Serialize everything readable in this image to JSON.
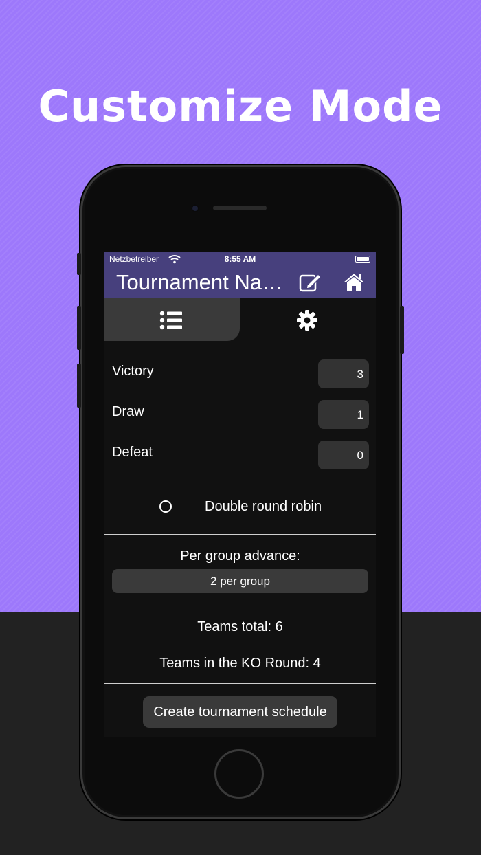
{
  "headline": "Customize Mode",
  "status_bar": {
    "carrier": "Netzbetreiber",
    "time": "8:55 AM"
  },
  "nav": {
    "title": "Tournament Na…",
    "icons": [
      "edit-icon",
      "home-icon"
    ]
  },
  "tabs": [
    {
      "icon": "list-icon",
      "selected": true
    },
    {
      "icon": "gear-icon",
      "selected": false
    }
  ],
  "points": [
    {
      "label": "Victory",
      "value": "3"
    },
    {
      "label": "Draw",
      "value": "1"
    },
    {
      "label": "Defeat",
      "value": "0"
    }
  ],
  "double_round_robin": {
    "label": "Double round robin",
    "checked": false
  },
  "advance": {
    "label": "Per group advance:",
    "selected": "2 per group"
  },
  "summary": {
    "teams_total": "Teams total: 6",
    "teams_ko": "Teams in the KO Round: 4"
  },
  "create_button": "Create tournament schedule",
  "colors": {
    "background_purple": "#9d78fb",
    "nav_bar": "#47407d",
    "screen_bg": "#111111",
    "control_bg": "#3a3a3a"
  }
}
